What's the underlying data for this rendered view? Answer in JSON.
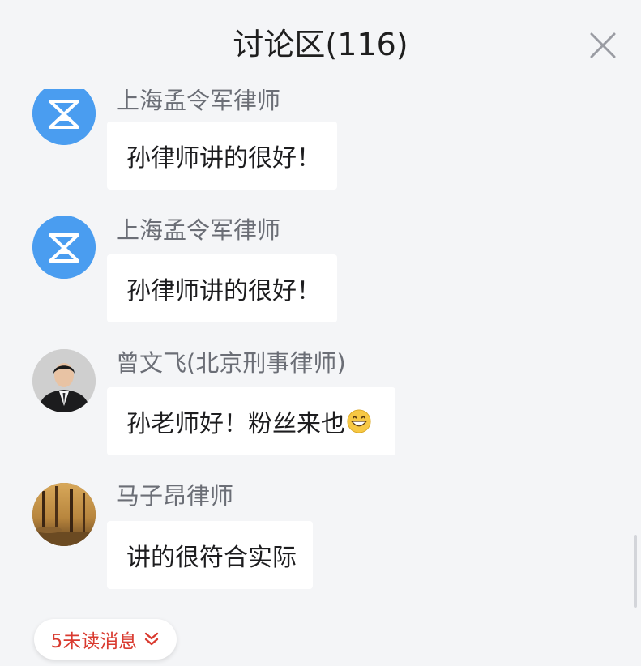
{
  "header": {
    "title": "讨论区(116)",
    "close_icon": "close-icon"
  },
  "messages": [
    {
      "sender": "上海孟令军律师",
      "text": "孙律师讲的很好！",
      "avatar": "hourglass-logo-avatar"
    },
    {
      "sender": "上海孟令军律师",
      "text": "孙律师讲的很好！",
      "avatar": "hourglass-logo-avatar"
    },
    {
      "sender": "曾文飞(北京刑事律师)",
      "text": "孙老师好！粉丝来也",
      "avatar": "man-in-suit-photo-avatar",
      "emoji": "grinning-face-emoji"
    },
    {
      "sender": "马子昂律师",
      "text": "讲的很符合实际",
      "avatar": "autumn-forest-photo-avatar"
    }
  ],
  "unread": {
    "label": "5未读消息",
    "icon": "double-chevron-down-icon"
  },
  "colors": {
    "background": "#f4f5f7",
    "bubble": "#ffffff",
    "sender_text": "#6b6e76",
    "avatar_blue": "#4a9df0",
    "unread_red": "#d93a2f"
  }
}
